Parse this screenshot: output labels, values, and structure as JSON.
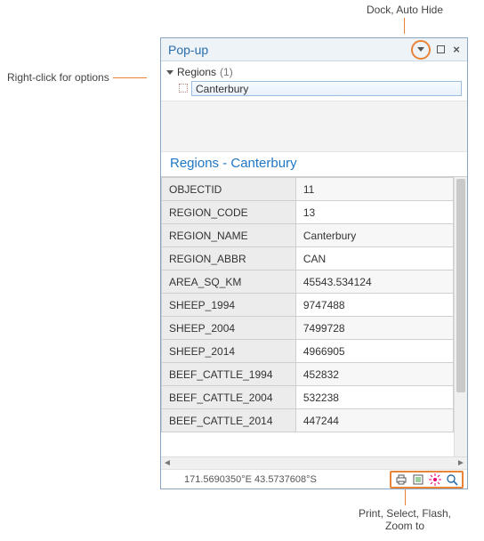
{
  "callouts": {
    "top": "Dock, Auto Hide",
    "left": "Right-click for options",
    "bottom_line1": "Print, Select, Flash,",
    "bottom_line2": "Zoom to"
  },
  "window": {
    "title": "Pop-up"
  },
  "tree": {
    "layer": "Regions",
    "count": "(1)",
    "selected": "Canterbury"
  },
  "section_title": "Regions - Canterbury",
  "attributes": [
    {
      "key": "OBJECTID",
      "val": "11"
    },
    {
      "key": "REGION_CODE",
      "val": "13"
    },
    {
      "key": "REGION_NAME",
      "val": "Canterbury"
    },
    {
      "key": "REGION_ABBR",
      "val": "CAN"
    },
    {
      "key": "AREA_SQ_KM",
      "val": "45543.534124"
    },
    {
      "key": "SHEEP_1994",
      "val": "9747488"
    },
    {
      "key": "SHEEP_2004",
      "val": "7499728"
    },
    {
      "key": "SHEEP_2014",
      "val": "4966905"
    },
    {
      "key": "BEEF_CATTLE_1994",
      "val": "452832"
    },
    {
      "key": "BEEF_CATTLE_2004",
      "val": "532238"
    },
    {
      "key": "BEEF_CATTLE_2014",
      "val": "447244"
    }
  ],
  "status": {
    "coords": "171.5690350°E 43.5737608°S"
  }
}
